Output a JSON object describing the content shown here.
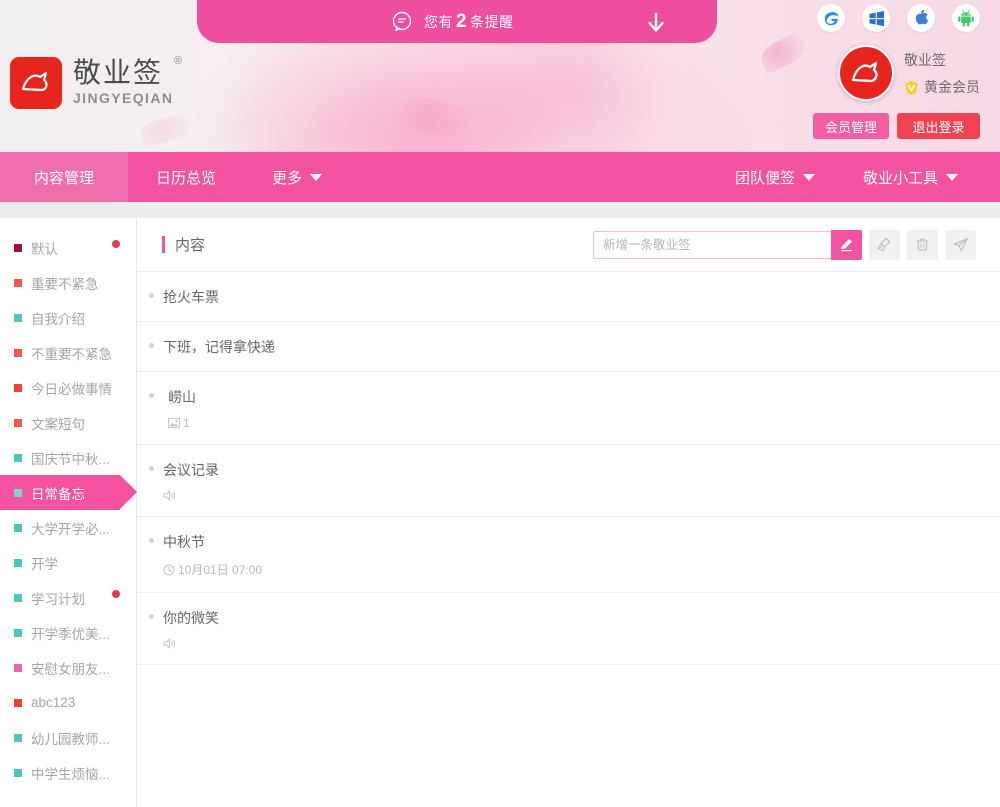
{
  "notification": {
    "icon": "speech-bubble-icon",
    "text_before": "您有",
    "count": "2",
    "text_after": "条提醒",
    "arrow_icon": "arrow-down-icon",
    "bg_color": "#ef4d9d"
  },
  "logo": {
    "icon": "jingyeqian-logo-icon",
    "cn_name": "敬业签",
    "registered_mark": "®",
    "en_name": "JINGYEQIAN",
    "mark_color": "#e8241f"
  },
  "platforms": [
    {
      "name": "ie-browser-icon",
      "label": "IE"
    },
    {
      "name": "windows-icon",
      "label": "Windows"
    },
    {
      "name": "apple-icon",
      "label": "Apple"
    },
    {
      "name": "android-icon",
      "label": "Android"
    }
  ],
  "user": {
    "avatar": "user-avatar-icon",
    "name": "敬业签",
    "level_badge": "gold-v-badge",
    "level": "黄金会员",
    "member_button": "会员管理",
    "logout_button": "退出登录",
    "member_button_color": "#f45ca4",
    "logout_button_color": "#ef4352"
  },
  "nav": {
    "active_color": "#f06dae",
    "bg_color": "#f2529f",
    "left_items": [
      {
        "label": "内容管理",
        "active": true,
        "has_caret": false
      },
      {
        "label": "日历总览",
        "active": false,
        "has_caret": false
      },
      {
        "label": "更多",
        "active": false,
        "has_caret": true
      }
    ],
    "right_items": [
      {
        "label": "团队便签",
        "has_caret": true
      },
      {
        "label": "敬业小工具",
        "has_caret": true
      }
    ]
  },
  "sidebar": {
    "items": [
      {
        "label": "默认",
        "color": "#9e1137",
        "selected": false,
        "dot": true
      },
      {
        "label": "重要不紧急",
        "color": "#f0594d",
        "selected": false,
        "dot": false
      },
      {
        "label": "自我介绍",
        "color": "#4ac8c0",
        "selected": false,
        "dot": false
      },
      {
        "label": "不重要不紧急",
        "color": "#f0594d",
        "selected": false,
        "dot": false
      },
      {
        "label": "今日必做事情",
        "color": "#e8453c",
        "selected": false,
        "dot": false
      },
      {
        "label": "文案短句",
        "color": "#f0594d",
        "selected": false,
        "dot": false
      },
      {
        "label": "国庆节中秋...",
        "color": "#4ac8c0",
        "selected": false,
        "dot": false
      },
      {
        "label": "日常备忘",
        "color": "#7fd4cd",
        "selected": true,
        "dot": false
      },
      {
        "label": "大学开学必...",
        "color": "#4ac8c0",
        "selected": false,
        "dot": false
      },
      {
        "label": "开学",
        "color": "#4ac8c0",
        "selected": false,
        "dot": false
      },
      {
        "label": "学习计划",
        "color": "#4ac8c0",
        "selected": false,
        "dot": true
      },
      {
        "label": "开学季优美...",
        "color": "#4ac8c0",
        "selected": false,
        "dot": false
      },
      {
        "label": "安慰女朋友...",
        "color": "#ef63b5",
        "selected": false,
        "dot": false
      },
      {
        "label": "abc123",
        "color": "#ef4135",
        "selected": false,
        "dot": false
      },
      {
        "label": "幼儿园教师...",
        "color": "#4ac8c0",
        "selected": false,
        "dot": false
      },
      {
        "label": "中学生烦恼...",
        "color": "#4ac8c0",
        "selected": false,
        "dot": false
      }
    ]
  },
  "main": {
    "title": "内容",
    "add_input": {
      "value": "",
      "placeholder": "新增一条敬业签"
    },
    "buttons": [
      {
        "name": "edit-button",
        "icon": "pencil-icon",
        "primary": true
      },
      {
        "name": "clean-button",
        "icon": "broom-icon",
        "primary": false
      },
      {
        "name": "delete-button",
        "icon": "trash-icon",
        "primary": false
      },
      {
        "name": "send-button",
        "icon": "paper-plane-icon",
        "primary": false
      }
    ],
    "notes": [
      {
        "text": "抢火车票",
        "meta_icon": "",
        "meta_text": "",
        "indent": false
      },
      {
        "text": "下班，记得拿快递",
        "meta_icon": "",
        "meta_text": "",
        "indent": false
      },
      {
        "text": "崂山",
        "meta_icon": "image-icon",
        "meta_text": "1",
        "indent": true
      },
      {
        "text": "会议记录",
        "meta_icon": "audio-icon",
        "meta_text": "",
        "indent": false
      },
      {
        "text": "中秋节",
        "meta_icon": "clock-icon",
        "meta_text": "10月01日 07:00",
        "indent": false
      },
      {
        "text": "你的微笑",
        "meta_icon": "audio-icon",
        "meta_text": "",
        "indent": false
      }
    ]
  }
}
